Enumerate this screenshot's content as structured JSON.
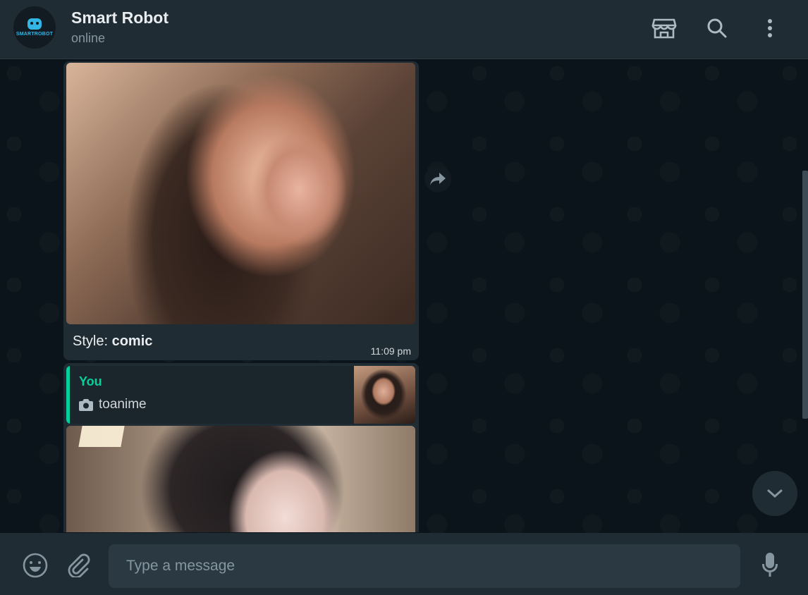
{
  "header": {
    "avatar_brand": "SMARTROBOT",
    "title": "Smart Robot",
    "status": "online",
    "icons": [
      "catalog-shop-icon",
      "search-icon",
      "menu-kebab-icon"
    ]
  },
  "messages": [
    {
      "type": "image",
      "caption_prefix": "Style: ",
      "caption_bold": "comic",
      "time": "11:09 pm"
    },
    {
      "type": "image-reply",
      "quote_author": "You",
      "quote_icon": "camera-icon",
      "quote_text": "toanime"
    }
  ],
  "footer": {
    "input_placeholder": "Type a message",
    "icons": [
      "emoji-icon",
      "attach-icon",
      "microphone-icon"
    ]
  },
  "colors": {
    "panel": "#202c33",
    "background": "#0b141a",
    "accent": "#06cf9c",
    "input": "#2a3942"
  }
}
